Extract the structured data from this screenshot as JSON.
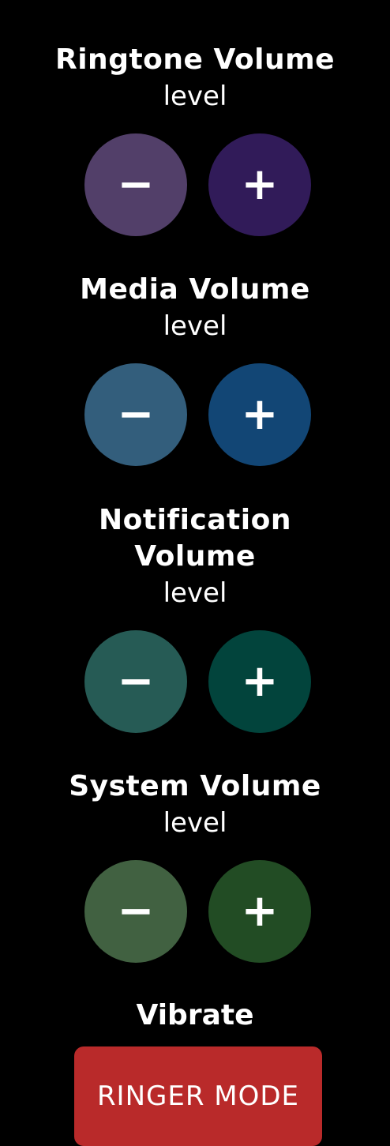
{
  "controls": [
    {
      "title": "Ringtone Volume",
      "level": "level",
      "minus_label": "−",
      "plus_label": "+",
      "minus_color": "#523f69",
      "plus_color": "#311b59",
      "minus_icon": "minus-icon",
      "plus_icon": "plus-icon"
    },
    {
      "title": "Media Volume",
      "level": "level",
      "minus_label": "−",
      "plus_label": "+",
      "minus_color": "#335e7c",
      "plus_color": "#124675",
      "minus_icon": "minus-icon",
      "plus_icon": "plus-icon"
    },
    {
      "title": "Notification Volume",
      "level": "level",
      "minus_label": "−",
      "plus_label": "+",
      "minus_color": "#265b55",
      "plus_color": "#02443c",
      "minus_icon": "minus-icon",
      "plus_icon": "plus-icon"
    },
    {
      "title": "System Volume",
      "level": "level",
      "minus_label": "−",
      "plus_label": "+",
      "minus_color": "#416141",
      "plus_color": "#224c24",
      "minus_icon": "minus-icon",
      "plus_icon": "plus-icon"
    }
  ],
  "vibrate": {
    "label": "Vibrate"
  },
  "ringer_mode": {
    "label": "RINGER MODE",
    "color": "#b92a2a"
  }
}
